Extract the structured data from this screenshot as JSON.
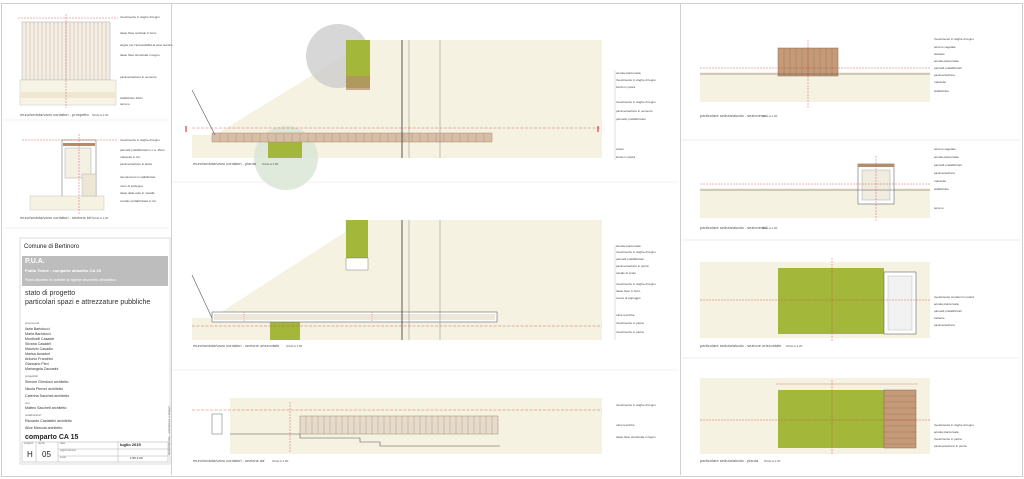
{
  "title_block": {
    "municipality": "Comune di Bertinoro",
    "plan": "P.U.A.",
    "project": "Fratta Terme - comparto attuativo CA 15",
    "subtitle": "Piano Attuativo in variante al vigente strumento urbanistico.",
    "phase": "stato di progetto",
    "sheet_title": "particolari spazi e attrezzature pubbliche",
    "proponents_label": "proponenti",
    "proponents": [
      "Ilaria Bartolucci",
      "Maria Bartolucci",
      "Monticelli Casadei",
      "Silvana Casadei",
      "Maurizio Casadio",
      "Marisa Amadori",
      "Antonio Franchini",
      "Giancarlo Pieri",
      "Mariangela Zaccarini"
    ],
    "designers_label": "progettisti",
    "designers": [
      "Simone Ghedurzi architetto",
      "Nicola Pieroni architetto",
      "Caterina Saccheti architetto"
    ],
    "with_label": "con",
    "with": [
      "Matteo Saccheti architetto"
    ],
    "collab_label": "collaboratori",
    "collaborators": [
      "Riccardo Castaldini architetto",
      "Alice Marcola architetto"
    ],
    "comparto": "comparto CA 15",
    "date": "luglio 2015",
    "code": "H",
    "sheet_number": "05",
    "scale": "1:50 1:20",
    "cell_labels": [
      "progetto",
      "tavola",
      "data",
      "aggiornamenti",
      "scala"
    ],
    "vertical_credit": "studiomarmile - architettura e design"
  },
  "captions": {
    "a1": "muro/seduta/vano contatori - prospetto",
    "a2": "muro/seduta/vano contatori - sezione bb'",
    "b1": "muro/seduta/vano contatori - pianta",
    "b2": "muro/seduta/vano contatori - sezione orizzontale",
    "b3": "muro/seduta/vano contatori - sezione aa'",
    "c1": "particolare seduta/aiuola - sezione cc'",
    "c2": "particolare seduta/aiuola - sezione dd'",
    "c3": "particolare seduta/aiuola - sezione orizzontale",
    "c4": "particolare seduta/aiuola - pianta",
    "scale_small": "SCALA 1:20",
    "scale_big": "SCALA 1:50"
  },
  "notes": {
    "a1": [
      "rivestimento in doghe di legno",
      "telaio fisso verticale in ferro",
      "doghe per l'accessibilità al vano tecnico",
      "telaio fisso strutturale in legno",
      "pavimentazione in cemento",
      "stabilizzato 10cm",
      "terreno"
    ],
    "a2": [
      "rivestimento in doghe di legno",
      "pannelli prefabbricati in c.a. 15cm",
      "massetto in cls",
      "pavimentazione in lastre",
      "riempimento in stabilizzato",
      "muro di sostegno",
      "telaio delle ante in metallo",
      "cordolo prefabbricato in cls"
    ],
    "b1": [
      "acuola piantumata",
      "rivestimento in doghe di legno",
      "bordo in pietra",
      "rivestimento in doghe di legno",
      "pavimentazione in cemento",
      "pannello prefabbricato",
      "scavo",
      "bordo in pietra"
    ],
    "b2": [
      "acuola piantumata",
      "rivestimento in doghe di legno",
      "pannelli prefabbricati",
      "pavimentazione in pietra",
      "canale di scolo",
      "rivestimento in doghe di legno",
      "telaio fisso in ferro",
      "nuove di appoggio",
      "varie tecniche",
      "rivestimento in pietra",
      "rivestimento in pietra"
    ],
    "b3": [
      "rivestimento in doghe di legno",
      "varie tecniche",
      "telaio fisso strutturale in legno"
    ],
    "c1": [
      "rivestimento in doghe di legno",
      "terreno vegetale",
      "tavolato",
      "acuola piantumata",
      "pannelli prefabbricati",
      "pavimentazione",
      "massetto",
      "stabilizzato"
    ],
    "c2": [
      "terreno vegetale",
      "acuola piantumata",
      "pannelli prefabbricati",
      "pavimentazione",
      "massetto",
      "stabilizzato",
      "terreno"
    ],
    "c3": [
      "rivestimento contatori in pietra",
      "acuola piantumata",
      "pannelli prefabbricati",
      "cadente",
      "pavimentazione"
    ],
    "c4": [
      "rivestimento in doghe di legno",
      "acuola piantumata",
      "rivestimento in pietra",
      "pavimentazione in pietra"
    ]
  },
  "colors": {
    "green": "#a3b83a",
    "green_light": "#b6c94f",
    "beige": "#f6f2e1",
    "wood": "#b58b6b",
    "gray_circle": "#c9c9c9",
    "green_circle": "#dbe6d6",
    "red": "#d24040",
    "title_bar": "#bdbdbd"
  }
}
